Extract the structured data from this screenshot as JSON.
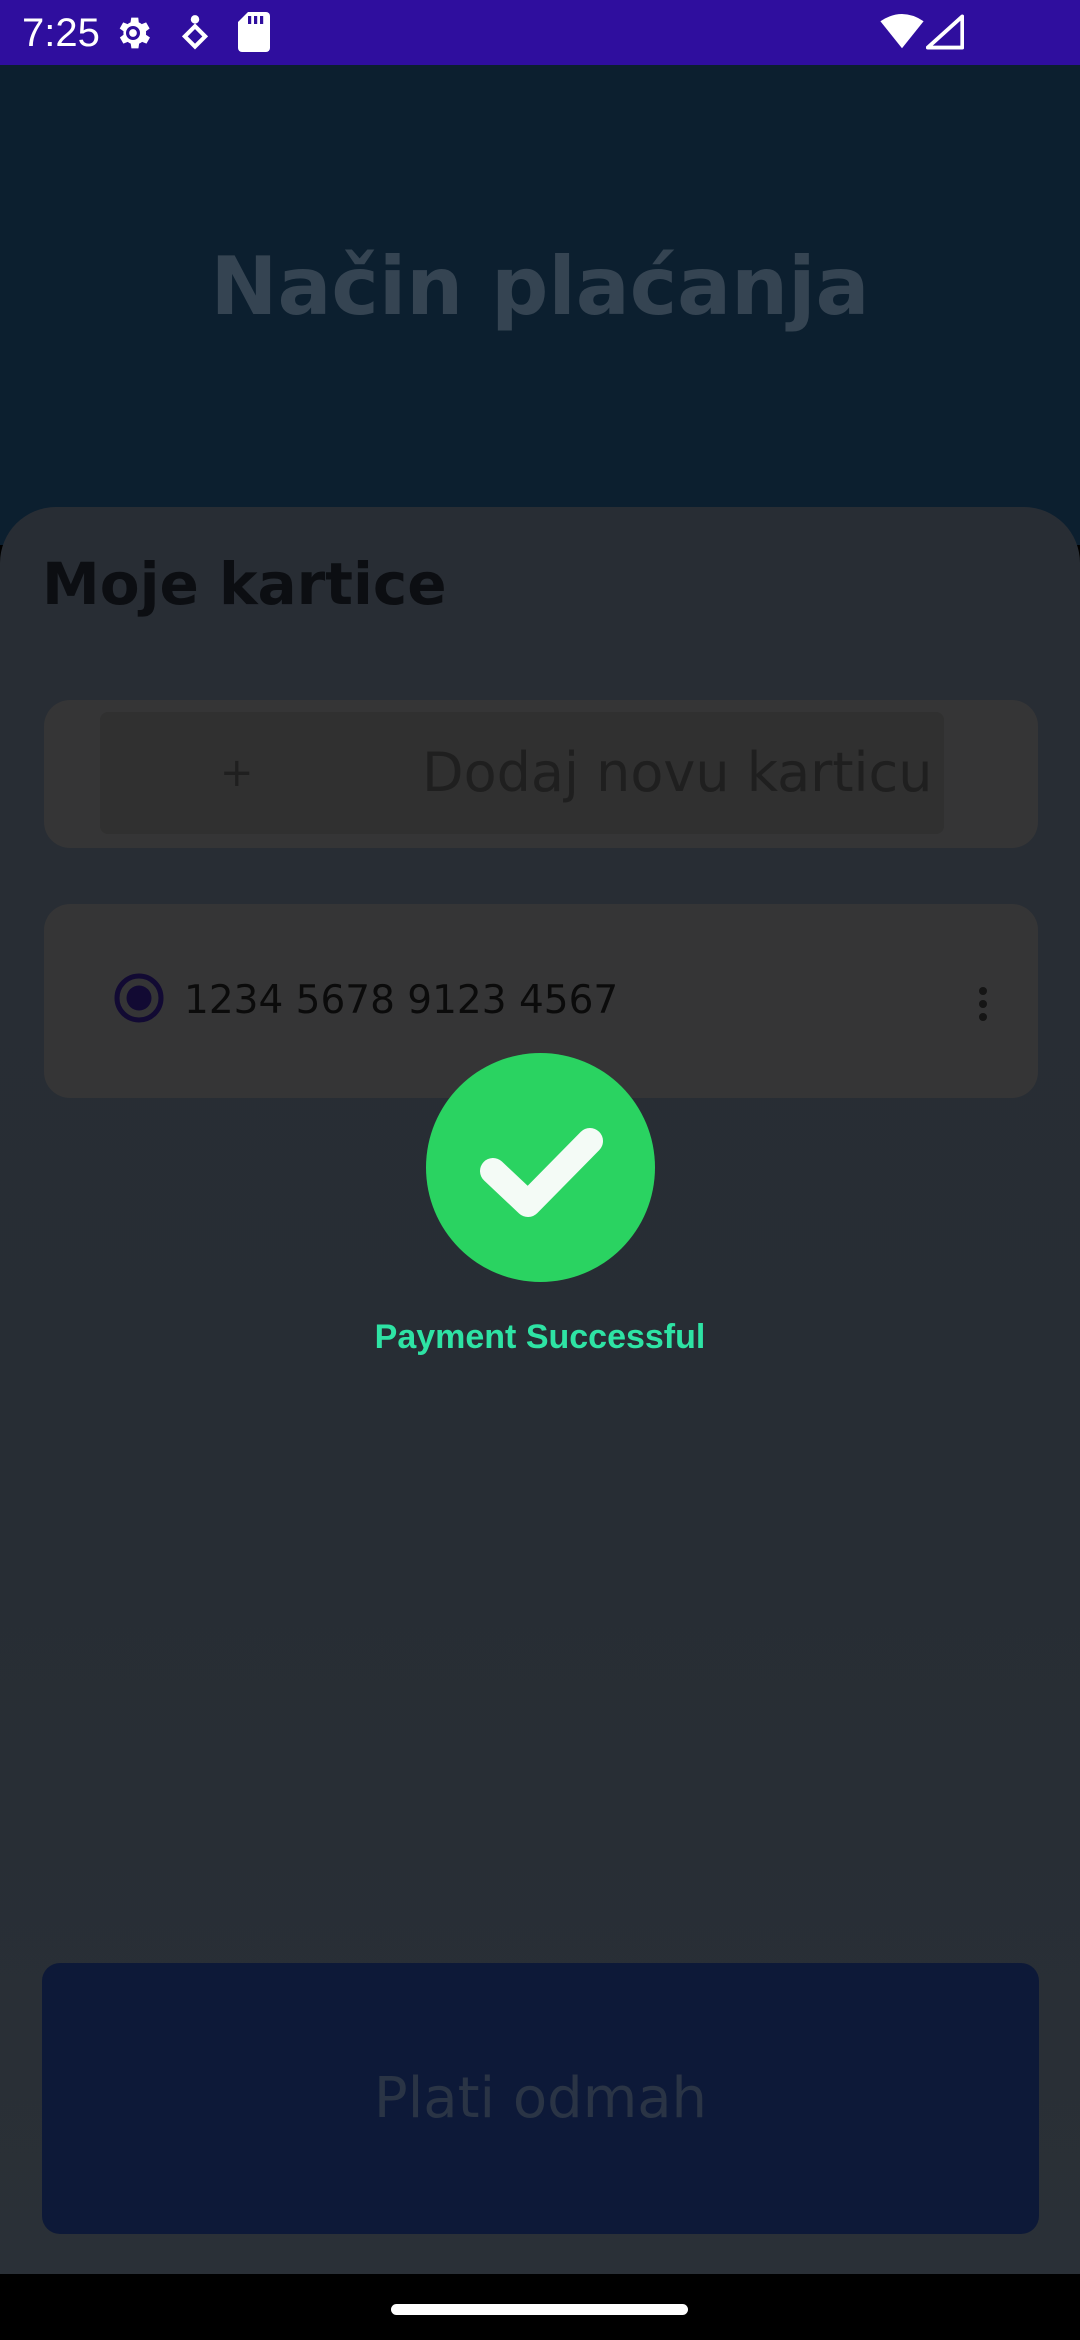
{
  "status_bar": {
    "time": "7:25",
    "icons": [
      "settings-gear-icon",
      "accessibility-icon",
      "sd-card-icon",
      "wifi-icon",
      "cell-signal-icon"
    ],
    "background_color": "#2f0e9e"
  },
  "header": {
    "title": "Način plaćanja"
  },
  "cards_section": {
    "title": "Moje kartice",
    "add_card": {
      "icon_text": "+",
      "label": "Dodaj novu karticu"
    },
    "cards": [
      {
        "number": "1234 5678 9123 4567",
        "selected": true,
        "menu_icon": "more-vertical-icon"
      }
    ]
  },
  "success_overlay": {
    "icon": "checkmark-icon",
    "message": "Payment Successful",
    "circle_color": "#2ad361",
    "text_color": "#2ee3a4"
  },
  "pay_button": {
    "label": "Plati odmah"
  }
}
